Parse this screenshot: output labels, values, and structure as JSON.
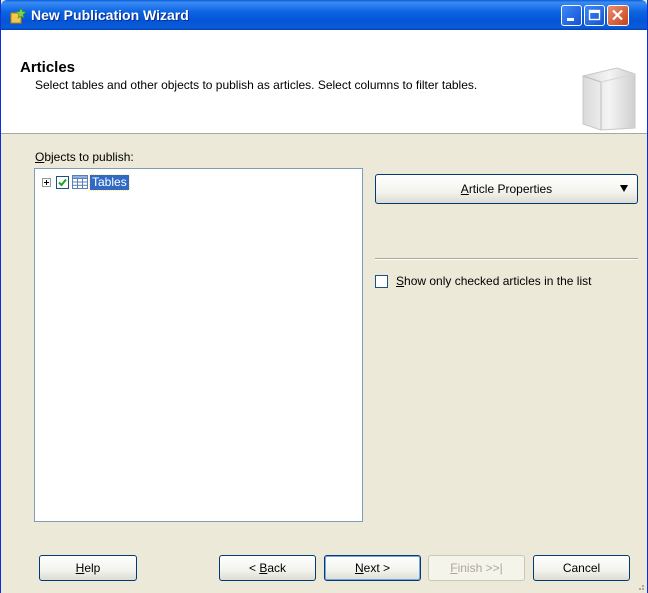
{
  "window": {
    "title": "New Publication Wizard"
  },
  "header": {
    "title": "Articles",
    "description": "Select tables and other objects to publish as articles. Select columns to filter tables."
  },
  "objects": {
    "label_key": "O",
    "label_rest": "bjects to publish:",
    "tree": [
      {
        "label": "Tables",
        "checked": true,
        "expanded": false,
        "selected": true
      }
    ]
  },
  "article_properties": {
    "label_key": "A",
    "label_rest": "rticle Properties"
  },
  "show_checked": {
    "label_key": "S",
    "label_rest": "how only checked articles in the list",
    "checked": false
  },
  "buttons": {
    "help": {
      "key": "H",
      "rest": "elp"
    },
    "back": {
      "prefix": "< ",
      "key": "B",
      "rest": "ack"
    },
    "next": {
      "key": "N",
      "rest": "ext >"
    },
    "finish": {
      "key": "F",
      "rest": "inish >>|",
      "enabled": false
    },
    "cancel": {
      "label": "Cancel"
    }
  }
}
